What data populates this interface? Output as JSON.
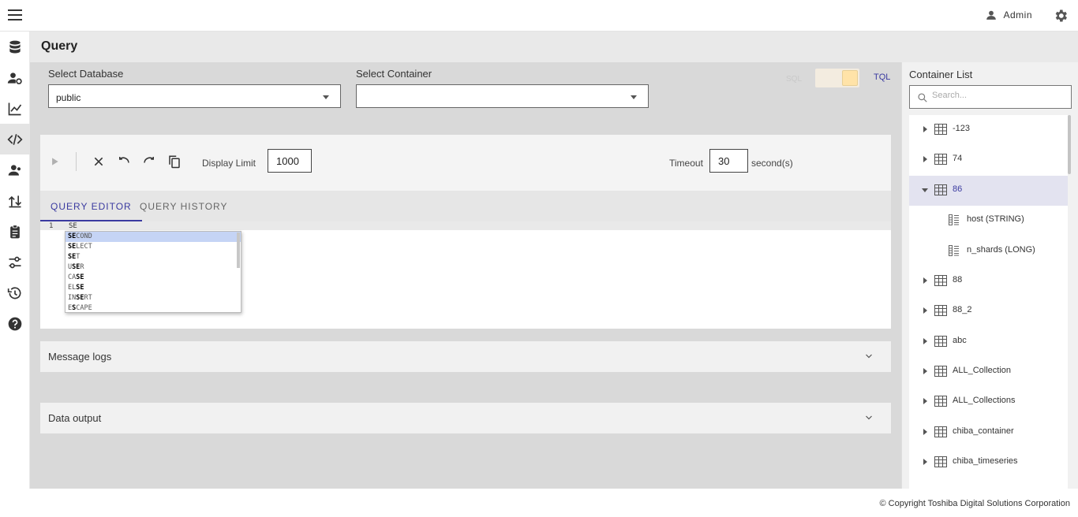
{
  "header": {
    "user_name": "Admin"
  },
  "page": {
    "title": "Query"
  },
  "selectors": {
    "database_label": "Select Database",
    "database_value": "public",
    "container_label": "Select Container",
    "container_value": ""
  },
  "mode_toggle": {
    "left_label": "SQL",
    "right_label": "TQL"
  },
  "toolbar": {
    "display_limit_label": "Display Limit",
    "display_limit_value": "1000",
    "timeout_label": "Timeout",
    "timeout_value": "30",
    "timeout_unit": "second(s)"
  },
  "tabs": [
    {
      "label": "QUERY EDITOR"
    },
    {
      "label": "QUERY HISTORY"
    }
  ],
  "editor": {
    "line_number": "1",
    "line_text": "SE"
  },
  "autocomplete": [
    {
      "match": "SE",
      "rest": "COND",
      "pre": ""
    },
    {
      "match": "SE",
      "rest": "LECT",
      "pre": ""
    },
    {
      "match": "SE",
      "rest": "T",
      "pre": ""
    },
    {
      "match": "SE",
      "rest": "R",
      "pre": "U"
    },
    {
      "match": "SE",
      "rest": "",
      "pre": "CA"
    },
    {
      "match": "SE",
      "rest": "",
      "pre": "EL"
    },
    {
      "match": "SE",
      "rest": "RT",
      "pre": "IN"
    },
    {
      "match": "S",
      "rest": "CAPE",
      "pre": "E"
    }
  ],
  "accordions": {
    "message_logs": "Message logs",
    "data_output": "Data output"
  },
  "container_list": {
    "title": "Container List",
    "search_placeholder": "Search...",
    "nodes": [
      {
        "name": "-123"
      },
      {
        "name": "74"
      },
      {
        "name": "86"
      },
      {
        "name": "host (STRING)"
      },
      {
        "name": "n_shards (LONG)"
      },
      {
        "name": "88"
      },
      {
        "name": "88_2"
      },
      {
        "name": "abc"
      },
      {
        "name": "ALL_Collection"
      },
      {
        "name": "ALL_Collections"
      },
      {
        "name": "chiba_container"
      },
      {
        "name": "chiba_timeseries"
      }
    ]
  },
  "footer": {
    "copyright": "© Copyright Toshiba Digital Solutions Corporation"
  },
  "colors": {
    "accent": "#3a3aa0",
    "toggle_knob": "#ffe3a8",
    "selected_row": "#e3e3f0"
  }
}
